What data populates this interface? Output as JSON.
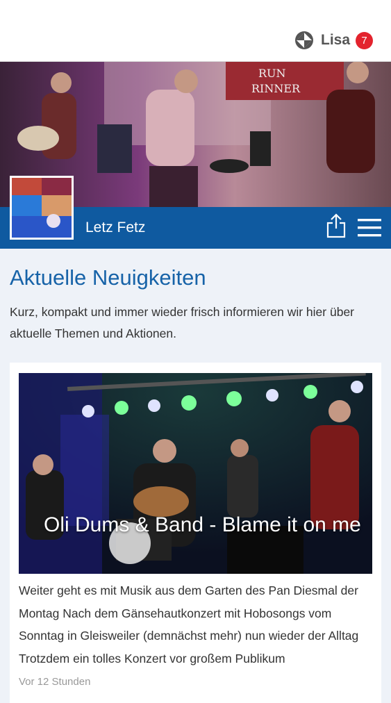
{
  "header": {
    "user_name": "Lisa",
    "notification_count": "7",
    "brand_icon": "tile-logo-icon"
  },
  "page": {
    "name": "Letz Fetz",
    "actions": {
      "share_icon": "share-icon",
      "menu_icon": "hamburger-menu-icon"
    }
  },
  "news": {
    "title": "Aktuelle Neuigkeiten",
    "intro": "Kurz, kompakt und immer wieder frisch informieren wir hier über aktuelle Themen und Aktionen."
  },
  "article": {
    "title": "Oli Dums & Band - Blame it on me",
    "text": "Weiter geht es mit Musik aus dem Garten des Pan Diesmal der Montag Nach dem Gänsehautkonzert mit Hobosongs vom Sonntag in Gleisweiler (demnächst mehr) nun wieder der Alltag Trotzdem ein tolles Konzert vor großem Publikum",
    "time": "Vor 12 Stunden"
  },
  "colors": {
    "accent_blue": "#0f5aa0",
    "title_blue": "#1763a8",
    "badge_red": "#e3232d",
    "background": "#eef2f8"
  }
}
